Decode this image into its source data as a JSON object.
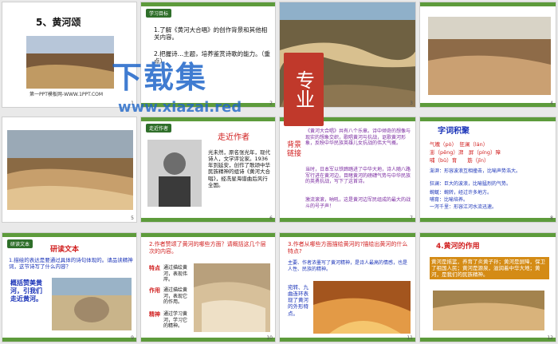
{
  "slides": [
    {
      "num": "1",
      "title": "5、黄河颂",
      "footer": "第一PPT模板网-WWW.1PPT.COM"
    },
    {
      "num": "2",
      "tag": "学习目标",
      "lines": [
        "1.了解《黄河大合唱》的创作背景和其他相关内容。",
        "2.把握诗…主题，培养鉴赏诗歌的能力。（重点）"
      ]
    },
    {
      "num": "3"
    },
    {
      "num": "4"
    },
    {
      "num": "5"
    },
    {
      "num": "6",
      "tag": "走近作者",
      "heading": "走近作者",
      "lines": [
        "光未然，原名张光年，现代诗人，文学评论家。1936年到延安，创作了歌颂中华民族精神的组诗《黄河大合唱》，经冼星海谱曲后风行全国。"
      ]
    },
    {
      "num": "7",
      "side": "背景链接",
      "lines": [
        "《黄河大合唱》共有八个乐章。诗中倾奇的想像与现实的想象交织，歌唱黄河与抗战，讴歌黄河形象，反映中华民族英雄儿女抗战的伟大气概。",
        "当时，日本军以铁蹄踏进了中华大地，诗人随八路军行进在黄河边，目睹黄河的磅礴气势与中华民族的英勇抗战，写下了这首诗。",
        "激流滚滚，呐吼，这是黄河边军民组成的最大的战斗的号子声！"
      ]
    },
    {
      "num": "8",
      "heading": "字词积聚",
      "lines": [
        "气魄（pò）　狂澜（lán）",
        "澎（pēng）湃　屏（píng）障",
        "哺（bǔ）育　　筋（jīn）",
        "澎湃：形容波浪互相撞击，比喻声势浩大。",
        "狂澜：巨大的波浪，比喻猛烈的气势。",
        "蜿蜒：蜿转，经过许多地方。",
        "哺育：比喻培养。",
        "一泻千里：形容江河水流迅速。"
      ]
    },
    {
      "num": "9",
      "tag": "研读文本",
      "heading": "研读文本",
      "lines": [
        "1.描绘的表达是要通过具体的诗句体现的。请品读精神词，这节诗写了什么内容？"
      ],
      "side": "概括赞美黄河，引我们走近黄河。"
    },
    {
      "num": "10",
      "heading": "2.作者赞颂了黄河的哪些方面？请概括这几个层次的内容。",
      "labels": [
        "特点",
        "作用",
        "精神"
      ],
      "lines": [
        "通过描绘黄河，表现伟岸。",
        "通过描绘黄河，表现它的作用。",
        "通过学习黄河，学习它的精神。"
      ]
    },
    {
      "num": "11",
      "heading": "3.作者从哪些方面描绘黄河的?描绘出黄河的什么特点?",
      "lines": [
        "主要、作者浓墨写了黄河精神，是诗人最高的情感，也是人性、民族的精神。",
        "写法、环境、特点、作用。"
      ],
      "side": "宛转、九曲连环表现了黄河的外形特点。"
    },
    {
      "num": "12",
      "heading": "4.黄河的作用",
      "lines": [
        "黄河是摇篮，养育了炎黄子孙；黄河是屏障，保卫了祖国人民；黄河是源泉，滋润着中华大地；黄河，是我们的民族精神。"
      ]
    }
  ],
  "watermark": {
    "main": "下载集",
    "sub": "www.xiazai.red",
    "badge": "专业"
  }
}
